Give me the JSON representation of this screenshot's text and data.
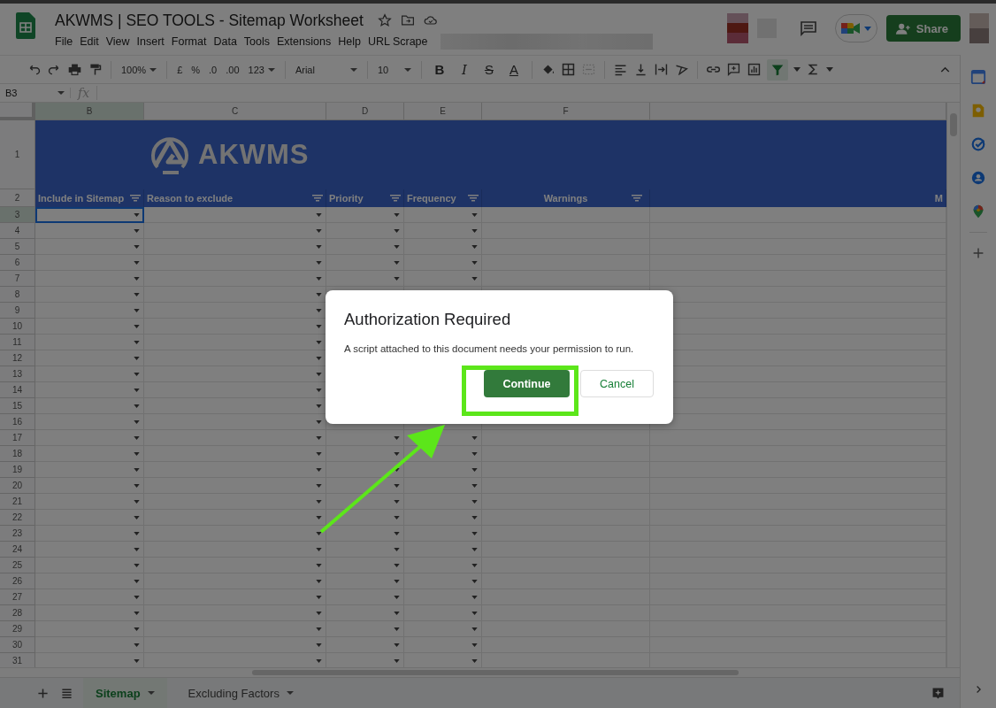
{
  "document": {
    "title": "AKWMS | SEO TOOLS - Sitemap Worksheet"
  },
  "menu": [
    "File",
    "Edit",
    "View",
    "Insert",
    "Format",
    "Data",
    "Tools",
    "Extensions",
    "Help",
    "URL Scrape"
  ],
  "share_button": "Share",
  "toolbar": {
    "zoom": "100%",
    "currency": "£",
    "percent": "%",
    "decrease_decimals": ".0",
    "increase_decimals": ".00",
    "number_format": "123",
    "font": "Arial",
    "font_size": "10",
    "bold": "B",
    "italic": "I",
    "strikethrough": "S",
    "text_color": "A",
    "filter_active": true
  },
  "name_box": "B3",
  "formula_label": "fx",
  "column_letters": [
    "B",
    "C",
    "D",
    "E",
    "F"
  ],
  "banner": {
    "row_number": "1",
    "logo_text": "AKWMS"
  },
  "header_row": {
    "number": "2",
    "cells": [
      "Include in Sitemap",
      "Reason to exclude",
      "Priority",
      "Frequency",
      "Warnings",
      "M"
    ]
  },
  "rows": [
    {
      "number": "3",
      "selected": true
    },
    {
      "number": "4",
      "selected": false
    },
    {
      "number": "5",
      "selected": false
    },
    {
      "number": "6",
      "selected": false
    },
    {
      "number": "7",
      "selected": false
    },
    {
      "number": "8",
      "selected": false
    },
    {
      "number": "9",
      "selected": false
    },
    {
      "number": "10",
      "selected": false
    },
    {
      "number": "11",
      "selected": false
    },
    {
      "number": "12",
      "selected": false
    },
    {
      "number": "13",
      "selected": false
    },
    {
      "number": "14",
      "selected": false
    },
    {
      "number": "15",
      "selected": false
    },
    {
      "number": "16",
      "selected": false
    },
    {
      "number": "17",
      "selected": false
    },
    {
      "number": "18",
      "selected": false
    },
    {
      "number": "19",
      "selected": false
    },
    {
      "number": "20",
      "selected": false
    },
    {
      "number": "21",
      "selected": false
    },
    {
      "number": "22",
      "selected": false
    },
    {
      "number": "23",
      "selected": false
    },
    {
      "number": "24",
      "selected": false
    },
    {
      "number": "25",
      "selected": false
    },
    {
      "number": "26",
      "selected": false
    },
    {
      "number": "27",
      "selected": false
    },
    {
      "number": "28",
      "selected": false
    },
    {
      "number": "29",
      "selected": false
    },
    {
      "number": "30",
      "selected": false
    },
    {
      "number": "31",
      "selected": false
    }
  ],
  "sheet_tabs": [
    {
      "label": "Sitemap",
      "selected": true
    },
    {
      "label": "Excluding Factors",
      "selected": false
    }
  ],
  "dialog": {
    "title": "Authorization Required",
    "message": "A script attached to this document needs your permission to run.",
    "buttons": [
      {
        "label": "Continue",
        "kind": "primary"
      },
      {
        "label": "Cancel",
        "kind": "secondary"
      }
    ]
  }
}
